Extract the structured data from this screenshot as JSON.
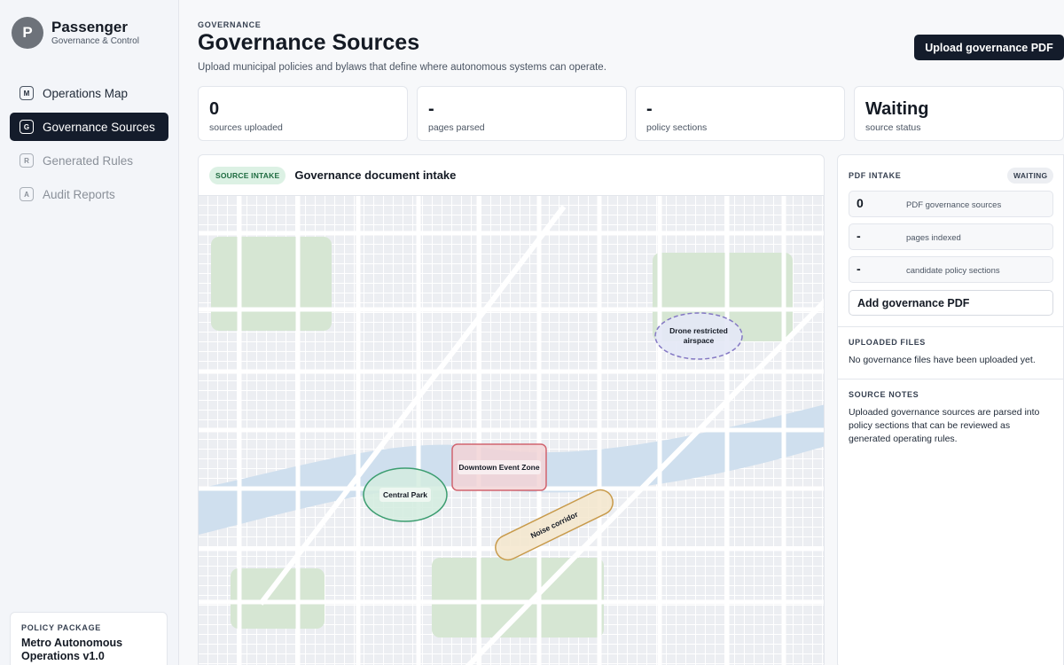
{
  "brand": {
    "initial": "P",
    "name": "Passenger",
    "subtitle": "Governance & Control"
  },
  "sidebar": {
    "items": [
      {
        "key": "M",
        "label": "Operations Map",
        "state": "normal"
      },
      {
        "key": "G",
        "label": "Governance Sources",
        "state": "active"
      },
      {
        "key": "R",
        "label": "Generated Rules",
        "state": "disabled"
      },
      {
        "key": "A",
        "label": "Audit Reports",
        "state": "disabled"
      }
    ],
    "package_label": "POLICY PACKAGE",
    "package_name": "Metro Autonomous Operations v1.0"
  },
  "header": {
    "eyebrow": "GOVERNANCE",
    "title": "Governance Sources",
    "description": "Upload municipal policies and bylaws that define where autonomous systems can operate.",
    "upload_button": "Upload governance PDF"
  },
  "stats": [
    {
      "value": "0",
      "label": "sources uploaded"
    },
    {
      "value": "-",
      "label": "pages parsed"
    },
    {
      "value": "-",
      "label": "policy sections"
    },
    {
      "value": "Waiting",
      "label": "source status"
    }
  ],
  "map": {
    "badge": "SOURCE INTAKE",
    "title": "Governance document intake",
    "zones": {
      "drone_line1": "Drone restricted",
      "drone_line2": "airspace",
      "downtown": "Downtown Event Zone",
      "park": "Central Park",
      "noise": "Noise corridor"
    },
    "colors": {
      "park": "#d6e6d3",
      "water": "#cfdfee",
      "road": "#ffffff",
      "block": "#eceef2"
    }
  },
  "intake": {
    "heading": "PDF INTAKE",
    "status_badge": "WAITING",
    "metrics": [
      {
        "value": "0",
        "label": "PDF governance sources"
      },
      {
        "value": "-",
        "label": "pages indexed"
      },
      {
        "value": "-",
        "label": "candidate policy sections"
      }
    ],
    "add_button": "Add governance PDF",
    "files_heading": "UPLOADED FILES",
    "files_empty": "No governance files have been uploaded yet.",
    "notes_heading": "SOURCE NOTES",
    "notes_text": "Uploaded governance sources are parsed into policy sections that can be reviewed as generated operating rules."
  }
}
